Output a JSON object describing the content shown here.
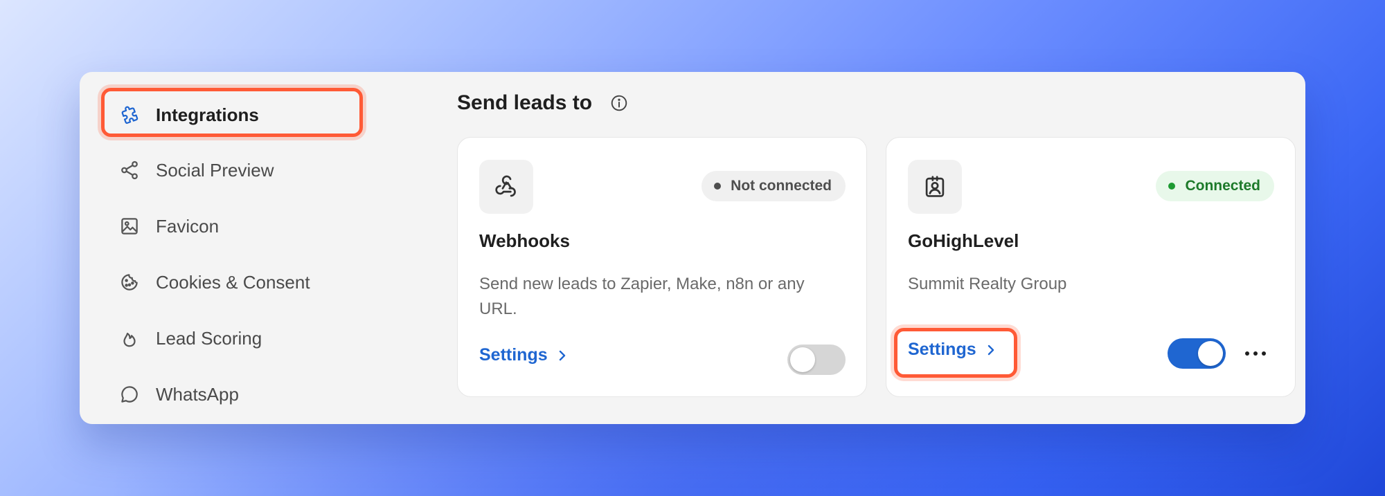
{
  "sidebar": {
    "items": [
      {
        "label": "Integrations",
        "icon": "puzzle-icon",
        "active": true
      },
      {
        "label": "Social Preview",
        "icon": "share-icon"
      },
      {
        "label": "Favicon",
        "icon": "image-icon"
      },
      {
        "label": "Cookies & Consent",
        "icon": "cookie-icon"
      },
      {
        "label": "Lead Scoring",
        "icon": "flame-icon"
      },
      {
        "label": "WhatsApp",
        "icon": "chat-bubble-icon"
      }
    ]
  },
  "main": {
    "title": "Send leads to",
    "info_icon": "info-icon",
    "cards": [
      {
        "name": "Webhooks",
        "icon": "webhook-icon",
        "status": "Not connected",
        "description": "Send new leads to Zapier, Make, n8n or any URL.",
        "settings_label": "Settings",
        "enabled": false
      },
      {
        "name": "GoHighLevel",
        "icon": "contact-badge-icon",
        "status": "Connected",
        "description": "Summit Realty Group",
        "settings_label": "Settings",
        "enabled": true
      }
    ]
  },
  "colors": {
    "accent": "#1f66d1",
    "highlight": "#ff5a36",
    "connected": "#1d7a2a",
    "connected_bg": "#e8f8ea"
  }
}
